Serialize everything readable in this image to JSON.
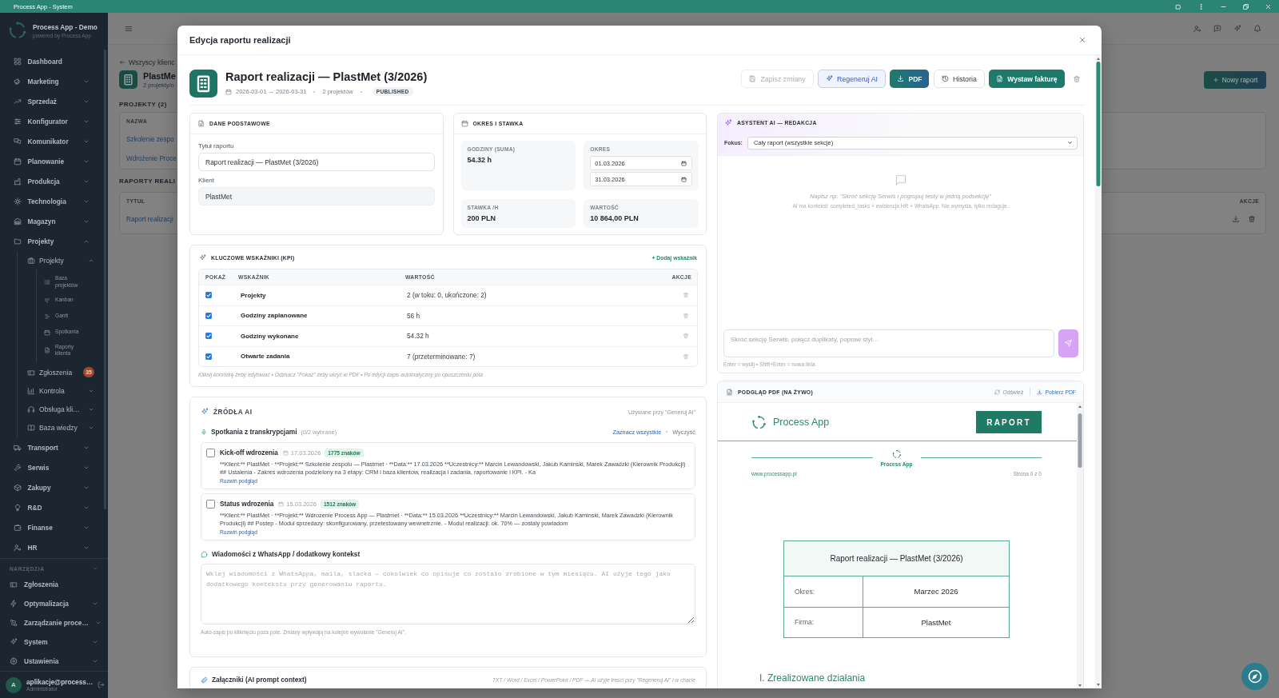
{
  "title_bar": {
    "title": "Process App - System"
  },
  "sidebar": {
    "brand": {
      "name": "Process App - Demo",
      "tagline": "powered by Process App"
    },
    "items": [
      {
        "label": "Dashboard"
      },
      {
        "label": "Marketing",
        "expanded": false
      },
      {
        "label": "Sprzedaż",
        "expanded": false
      },
      {
        "label": "Konfigurator",
        "expanded": false
      },
      {
        "label": "Komunikator",
        "expanded": false
      },
      {
        "label": "Planowanie",
        "expanded": false
      },
      {
        "label": "Produkcja",
        "expanded": false
      },
      {
        "label": "Technologia",
        "expanded": false
      },
      {
        "label": "Magazyn",
        "expanded": false
      },
      {
        "label": "Projekty",
        "expanded": true,
        "children": [
          {
            "label": "Projekty",
            "expanded": true,
            "children": [
              {
                "label": "Baza projektów"
              },
              {
                "label": "Kanban"
              },
              {
                "label": "Gantt"
              },
              {
                "label": "Spotkania"
              },
              {
                "label": "Raporty klienta"
              }
            ]
          },
          {
            "label": "Zgłoszenia",
            "badge": "35"
          },
          {
            "label": "Kontrola",
            "expanded": false
          },
          {
            "label": "Obsługa kli…",
            "expanded": false
          },
          {
            "label": "Baza wiedzy",
            "expanded": false
          }
        ]
      },
      {
        "label": "Transport",
        "expanded": false
      },
      {
        "label": "Serwis",
        "expanded": false
      },
      {
        "label": "Zakupy",
        "expanded": false
      },
      {
        "label": "R&D",
        "expanded": false
      },
      {
        "label": "Finanse",
        "expanded": false
      },
      {
        "label": "HR",
        "expanded": false
      }
    ],
    "tools": {
      "label": "NARZĘDZIA",
      "expanded": true,
      "items": [
        {
          "label": "Zgłoszenia"
        },
        {
          "label": "Optymalizacja",
          "expanded": false
        },
        {
          "label": "Zarządzanie proce…",
          "expanded": false
        },
        {
          "label": "System",
          "expanded": false
        },
        {
          "label": "Ustawienia",
          "expanded": false
        }
      ]
    },
    "user": {
      "initial": "A",
      "name": "aplikacje@process…",
      "role": "Administrator"
    }
  },
  "background_page": {
    "back_link": "Wszyscy klienc",
    "client": {
      "name": "PlastMe",
      "meta": "2 projekty/o"
    },
    "new_report_button": "Nowy raport",
    "projects": {
      "heading": "PROJEKTY (2)",
      "column": "NAZWA",
      "rows": [
        "Szkolenie zespo",
        "Wdrożenie Proce"
      ]
    },
    "reports": {
      "heading": "RAPORTY REALI",
      "columns": [
        "TYTUŁ",
        "AKCJE"
      ],
      "rows": [
        "Raport realizacji"
      ]
    }
  },
  "modal": {
    "title": "Edycja raportu realizacji",
    "report": {
      "title": "Raport realizacji — PlastMet (3/2026)",
      "period": "2026-03-01 → 2026-03-31",
      "projects": "2 projektów",
      "status": "PUBLISHED"
    },
    "actions": [
      {
        "kind": "save",
        "label": "Zapisz zmiany",
        "disabled": true
      },
      {
        "kind": "ai",
        "label": "Regeneruj AI",
        "disabled": false
      },
      {
        "kind": "pdf",
        "label": "PDF",
        "disabled": false
      },
      {
        "kind": "history",
        "label": "Historia",
        "disabled": false
      },
      {
        "kind": "invoice",
        "label": "Wystaw fakturę",
        "disabled": false
      },
      {
        "kind": "delete",
        "disabled": false
      }
    ],
    "basic_data": {
      "title": "DANE PODSTAWOWE",
      "fields": [
        {
          "label": "Tytuł raportu",
          "value": "Raport realizacji — PlastMet (3/2026)",
          "readonly": false
        },
        {
          "label": "Klient",
          "value": "PlastMet",
          "readonly": true
        }
      ]
    },
    "period_rate": {
      "title": "OKRES I STAWKA",
      "tiles": [
        {
          "kind": "stat",
          "label": "GODZINY (SUMA)",
          "value": "54.32 h"
        },
        {
          "kind": "dates",
          "label": "OKRES",
          "values": [
            "01.03.2026",
            "31.03.2026"
          ]
        },
        {
          "kind": "stat",
          "label": "STAWKA /H",
          "value": "200 PLN"
        },
        {
          "kind": "stat",
          "label": "WARTOŚĆ",
          "value": "10 864,00 PLN"
        }
      ]
    },
    "kpi": {
      "title": "KLUCZOWE WSKAŹNIKI (KPI)",
      "add_link": "+ Dodaj wskaźnik",
      "columns": [
        "POKAŻ",
        "WSKAŹNIK",
        "WARTOŚĆ",
        "AKCJE"
      ],
      "rows": [
        {
          "checked": true,
          "name": "Projekty",
          "value": "2 (w toku: 0, ukończone: 2)"
        },
        {
          "checked": true,
          "name": "Godziny zaplanowane",
          "value": "56 h"
        },
        {
          "checked": true,
          "name": "Godziny wykonane",
          "value": "54.32 h"
        },
        {
          "checked": true,
          "name": "Otwarte zadania",
          "value": "7 (przeterminowane: 7)"
        }
      ],
      "note": "Kliknij komórkę żeby edytować • Odznacz \"Pokaż\" żeby ukryć w PDF • Po edycji zapis automatyczny po opuszczeniu pola"
    },
    "ai_sources": {
      "title": "ŹRÓDŁA AI",
      "hint": "Używane przy \"Generuj AI\"",
      "meetings": {
        "title": "Spotkania z transkrypcjami",
        "count": "(0/2 wybrane)",
        "select_all": "Zaznacz wszystkie",
        "clear": "Wyczyść",
        "items": [
          {
            "checked": false,
            "title": "Kick-off wdrozenia",
            "date": "17.03.2026",
            "chars": "1775 znaków",
            "excerpt": "**Klient:** PlastMet · **Projekt:** Szkolenie zespolu — Plastmet · **Data:** 17.03.2026 **Uczestnicy:** Marcin Lewandowski, Jakub Kaminski, Marek Zawadzki (Kierownik Produkcji) ## Ustalenia - Zakres wdrozenia podzielony na 3 etapy: CRM i baza klientow, realizacja i zadania, raportowanie i KPI. - Ka",
            "expand": "Rozwiń podgląd"
          },
          {
            "checked": false,
            "title": "Status wdrozenia",
            "date": "15.03.2026",
            "chars": "1512 znaków",
            "excerpt": "**Klient:** PlastMet · **Projekt:** Wdrozenie Process App — Plastmet · **Data:** 15.03.2026 **Uczestnicy:** Marcin Lewandowski, Jakub Kaminski, Marek Zawadzki (Kierownik Produkcji) ## Postep - Modul sprzedazy: skonfigurowany, przetestowany wewnetrznie. - Modul realizacji: ok. 70% — zostaly powiadom",
            "expand": "Rozwiń podgląd"
          }
        ]
      },
      "context": {
        "title": "Wiadomości z WhatsApp / dodatkowy kontekst",
        "placeholder": "Wklej wiadomości z WhatsAppa, maila, slacka — cokolwiek co opisuje co zostało zrobione w tym miesiącu. AI użyje tego jako dodatkowego kontekstu przy generowaniu raportu.",
        "note": "Auto-zapis po kliknięciu poza pole. Zmiany wpływają na kolejne wywołanie \"Generuj AI\"."
      }
    },
    "attachments": {
      "title": "Załączniki (AI prompt context)",
      "hint": "TXT / Word / Excel / PowerPoint / PDF — AI użyje treści przy \"Regeneruj AI\" i w chacie"
    },
    "assistant": {
      "title": "ASYSTENT AI — REDAKCJA",
      "focus_label": "Fokus:",
      "focus_value": "Cały raport (wszystkie sekcje)",
      "empty_hint": "Napisz np. \"Skróć sekcję Serwis i pogrupuj testy w jedną podsekcję\"",
      "empty_note": "AI ma kontekst: completed_tasks + ewidencja HR + WhatsApp. Nie wymyśla, tylko redaguje.",
      "input_placeholder": "Skróć sekcję Serwis, połącz duplikaty, popraw styl…",
      "input_hint": "Enter = wyślij • Shift+Enter = nowa linia"
    },
    "pdf_preview": {
      "title": "PODGLĄD PDF (NA ŻYWO)",
      "refresh": "Odśwież",
      "download": "Pobierz PDF",
      "document": {
        "brand": "Process App",
        "badge": "RAPORT",
        "band_brand": "Process App",
        "website": "www.processapp.pl",
        "page": "Strona 0 z 0",
        "table": {
          "title": "Raport realizacji — PlastMet (3/2026)",
          "rows": [
            {
              "label": "Okres:",
              "value": "Marzec 2026"
            },
            {
              "label": "Firma:",
              "value": "PlastMet"
            }
          ]
        },
        "section": "I. Zrealizowane działania"
      }
    }
  }
}
